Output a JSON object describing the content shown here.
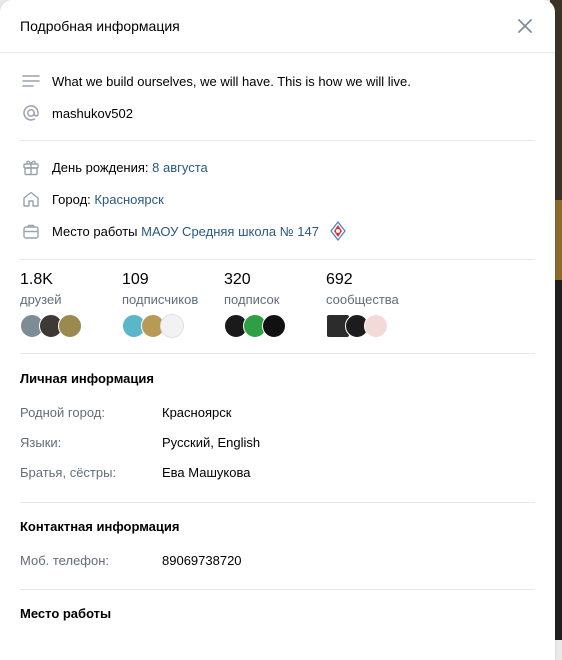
{
  "header": {
    "title": "Подробная информация"
  },
  "status": {
    "text": "What we build ourselves, we will have. This is how we will live."
  },
  "username": {
    "text": "mashukov502"
  },
  "birthday": {
    "label": "День рождения:",
    "value": "8 августа"
  },
  "city": {
    "label": "Город:",
    "value": "Красноярск"
  },
  "work": {
    "label": "Место работы",
    "value": "МАОУ Средняя школа № 147"
  },
  "counters": [
    {
      "num": "1.8K",
      "label": "друзей"
    },
    {
      "num": "109",
      "label": "подписчиков"
    },
    {
      "num": "320",
      "label": "подписок"
    },
    {
      "num": "692",
      "label": "сообщества"
    }
  ],
  "personal": {
    "title": "Личная информация",
    "rows": [
      {
        "key": "Родной город:",
        "value": "Красноярск"
      },
      {
        "key": "Языки:",
        "value": "Русский, English"
      },
      {
        "key": "Братья, сёстры:",
        "value": "Ева Машукова"
      }
    ]
  },
  "contact": {
    "title": "Контактная информация",
    "rows": [
      {
        "key": "Моб. телефон:",
        "value": "89069738720"
      }
    ]
  },
  "work_section": {
    "title": "Место работы"
  },
  "icons": {
    "status": "menu-lines-icon",
    "username": "at-sign-icon",
    "birthday": "gift-icon",
    "city": "home-icon",
    "work": "briefcase-icon",
    "close": "close-icon",
    "school_logo": "school-logo-icon"
  },
  "colors": {
    "link": "#2a5885",
    "icon": "#99a2ad",
    "muted": "#626d7a",
    "divider": "#e7e8ec"
  }
}
